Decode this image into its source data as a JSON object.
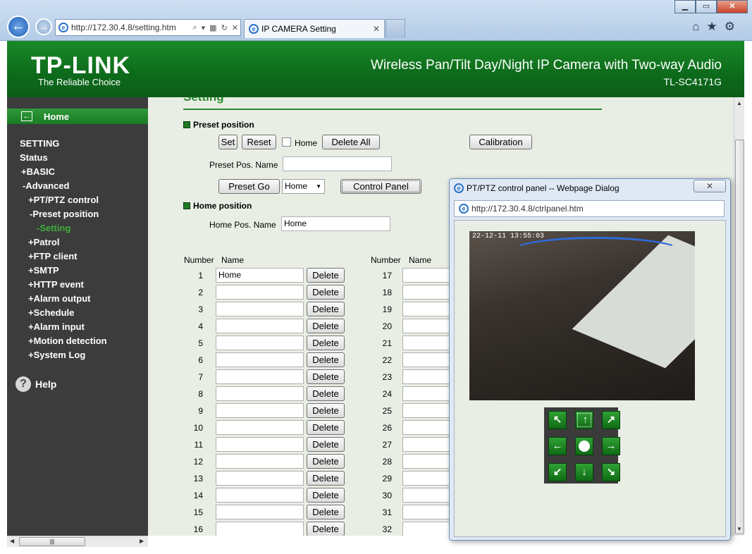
{
  "browser": {
    "address_url": "http://172.30.4.8/setting.htm",
    "tab_title": "IP CAMERA Setting",
    "tab_close": "✕",
    "window_buttons": [
      "▁",
      "▭",
      "✕"
    ],
    "toolbar_icons": [
      "home-icon",
      "star-icon",
      "gear-icon"
    ]
  },
  "header": {
    "logo": "TP-LINK",
    "slogan": "The Reliable Choice",
    "product_title": "Wireless Pan/Tilt Day/Night IP Camera with Two-way Audio",
    "model": "TL-SC4171G",
    "accent_color": "#1b8a27"
  },
  "sidebar": {
    "home_label": "Home",
    "items": [
      {
        "label": "SETTING",
        "indent": 18,
        "active": false
      },
      {
        "label": "Status",
        "indent": 18,
        "active": false
      },
      {
        "label": "+BASIC",
        "indent": 20,
        "active": false
      },
      {
        "label": "-Advanced",
        "indent": 22,
        "active": false
      },
      {
        "label": "+PT/PTZ control",
        "indent": 30,
        "active": false
      },
      {
        "label": "-Preset position",
        "indent": 32,
        "active": false
      },
      {
        "label": "-Setting",
        "indent": 42,
        "active": true
      },
      {
        "label": "+Patrol",
        "indent": 30,
        "active": false
      },
      {
        "label": "+FTP client",
        "indent": 30,
        "active": false
      },
      {
        "label": "+SMTP",
        "indent": 30,
        "active": false
      },
      {
        "label": "+HTTP event",
        "indent": 30,
        "active": false
      },
      {
        "label": "+Alarm output",
        "indent": 30,
        "active": false
      },
      {
        "label": "+Schedule",
        "indent": 30,
        "active": false
      },
      {
        "label": "+Alarm input",
        "indent": 30,
        "active": false
      },
      {
        "label": "+Motion detection",
        "indent": 30,
        "active": false
      },
      {
        "label": "+System Log",
        "indent": 30,
        "active": false
      }
    ],
    "help_label": "Help"
  },
  "main": {
    "title": "Setting",
    "preset_section": "Preset position",
    "buttons": {
      "set": "Set",
      "reset": "Reset",
      "delete_all": "Delete All",
      "calibration": "Calibration",
      "preset_go": "Preset Go",
      "control_panel": "Control Panel",
      "delete": "Delete"
    },
    "home_checkbox_label": "Home",
    "preset_pos_name_label": "Preset Pos. Name",
    "preset_pos_name_value": "",
    "preset_select_value": "Home",
    "home_section": "Home position",
    "home_pos_name_label": "Home Pos. Name",
    "home_pos_name_value": "Home",
    "table": {
      "col_number": "Number",
      "col_name": "Name",
      "left_rows": [
        {
          "num": "1",
          "name": "Home"
        },
        {
          "num": "2",
          "name": ""
        },
        {
          "num": "3",
          "name": ""
        },
        {
          "num": "4",
          "name": ""
        },
        {
          "num": "5",
          "name": ""
        },
        {
          "num": "6",
          "name": ""
        },
        {
          "num": "7",
          "name": ""
        },
        {
          "num": "8",
          "name": ""
        },
        {
          "num": "9",
          "name": ""
        },
        {
          "num": "10",
          "name": ""
        },
        {
          "num": "11",
          "name": ""
        },
        {
          "num": "12",
          "name": ""
        },
        {
          "num": "13",
          "name": ""
        },
        {
          "num": "14",
          "name": ""
        },
        {
          "num": "15",
          "name": ""
        },
        {
          "num": "16",
          "name": ""
        }
      ],
      "right_rows": [
        {
          "num": "17",
          "name": ""
        },
        {
          "num": "18",
          "name": ""
        },
        {
          "num": "19",
          "name": ""
        },
        {
          "num": "20",
          "name": ""
        },
        {
          "num": "21",
          "name": ""
        },
        {
          "num": "22",
          "name": ""
        },
        {
          "num": "23",
          "name": ""
        },
        {
          "num": "24",
          "name": ""
        },
        {
          "num": "25",
          "name": ""
        },
        {
          "num": "26",
          "name": ""
        },
        {
          "num": "27",
          "name": ""
        },
        {
          "num": "28",
          "name": ""
        },
        {
          "num": "29",
          "name": ""
        },
        {
          "num": "30",
          "name": ""
        },
        {
          "num": "31",
          "name": ""
        },
        {
          "num": "32",
          "name": ""
        }
      ]
    }
  },
  "dialog": {
    "title": "PT/PTZ control panel -- Webpage Dialog",
    "close": "✕",
    "url": "http://172.30.4.8/ctrlpanel.htm",
    "camera_timestamp": "22-12-11 13:55:03",
    "ptz_buttons": [
      {
        "name": "ptz-up-left-button",
        "glyph": "↖"
      },
      {
        "name": "ptz-up-button",
        "glyph": "↑"
      },
      {
        "name": "ptz-up-right-button",
        "glyph": "↗"
      },
      {
        "name": "ptz-left-button",
        "glyph": "←"
      },
      {
        "name": "ptz-center-button",
        "glyph": ""
      },
      {
        "name": "ptz-right-button",
        "glyph": "→"
      },
      {
        "name": "ptz-down-left-button",
        "glyph": "↙"
      },
      {
        "name": "ptz-down-button",
        "glyph": "↓"
      },
      {
        "name": "ptz-down-right-button",
        "glyph": "↘"
      }
    ]
  }
}
